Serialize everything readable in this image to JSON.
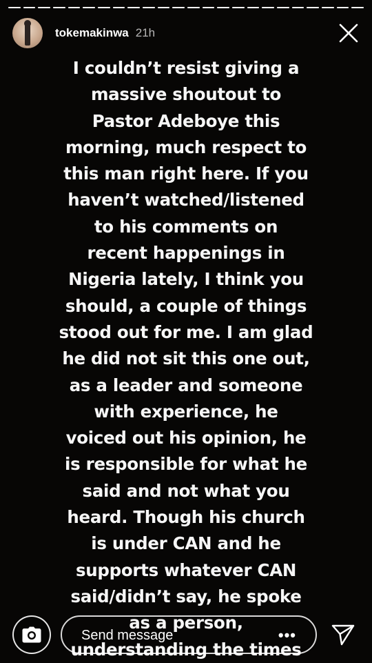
{
  "story": {
    "progress": [
      1,
      1,
      1,
      1,
      1,
      1,
      1,
      1,
      1,
      1,
      1,
      1,
      1,
      1,
      1,
      1,
      1,
      1,
      1,
      1,
      1,
      1,
      1,
      1
    ],
    "current_segment": 0
  },
  "header": {
    "username": "tokemakinwa",
    "time_ago": "21h",
    "close_icon": "close-icon",
    "avatar_icon": "avatar"
  },
  "text_lines": [
    "I couldn’t resist giving a",
    "massive shoutout to",
    "Pastor Adeboye this",
    "morning, much respect to",
    "this man right here. If you",
    "haven’t watched/listened",
    "to his comments on",
    "recent happenings in",
    "Nigeria lately, I think you",
    "should, a couple of things",
    "stood out for me. I am glad",
    "he did not sit this one out,",
    "as a leader and someone",
    "with experience, he",
    "voiced out his opinion, he",
    "is responsible for what he",
    "said and not what you",
    "heard. Though his church",
    "is under CAN and he",
    "supports whatever CAN",
    "said/didn’t say, he spoke",
    "as a person,",
    "understanding the times"
  ],
  "bottom_bar": {
    "camera_icon": "camera-icon",
    "message_placeholder": "Send message",
    "more_label": "•••",
    "send_icon": "send-icon"
  },
  "colors": {
    "background": "#070605",
    "text": "#f6f6f6",
    "progress_active": "#ffffff",
    "progress_inactive": "rgba(255,255,255,0.35)"
  }
}
